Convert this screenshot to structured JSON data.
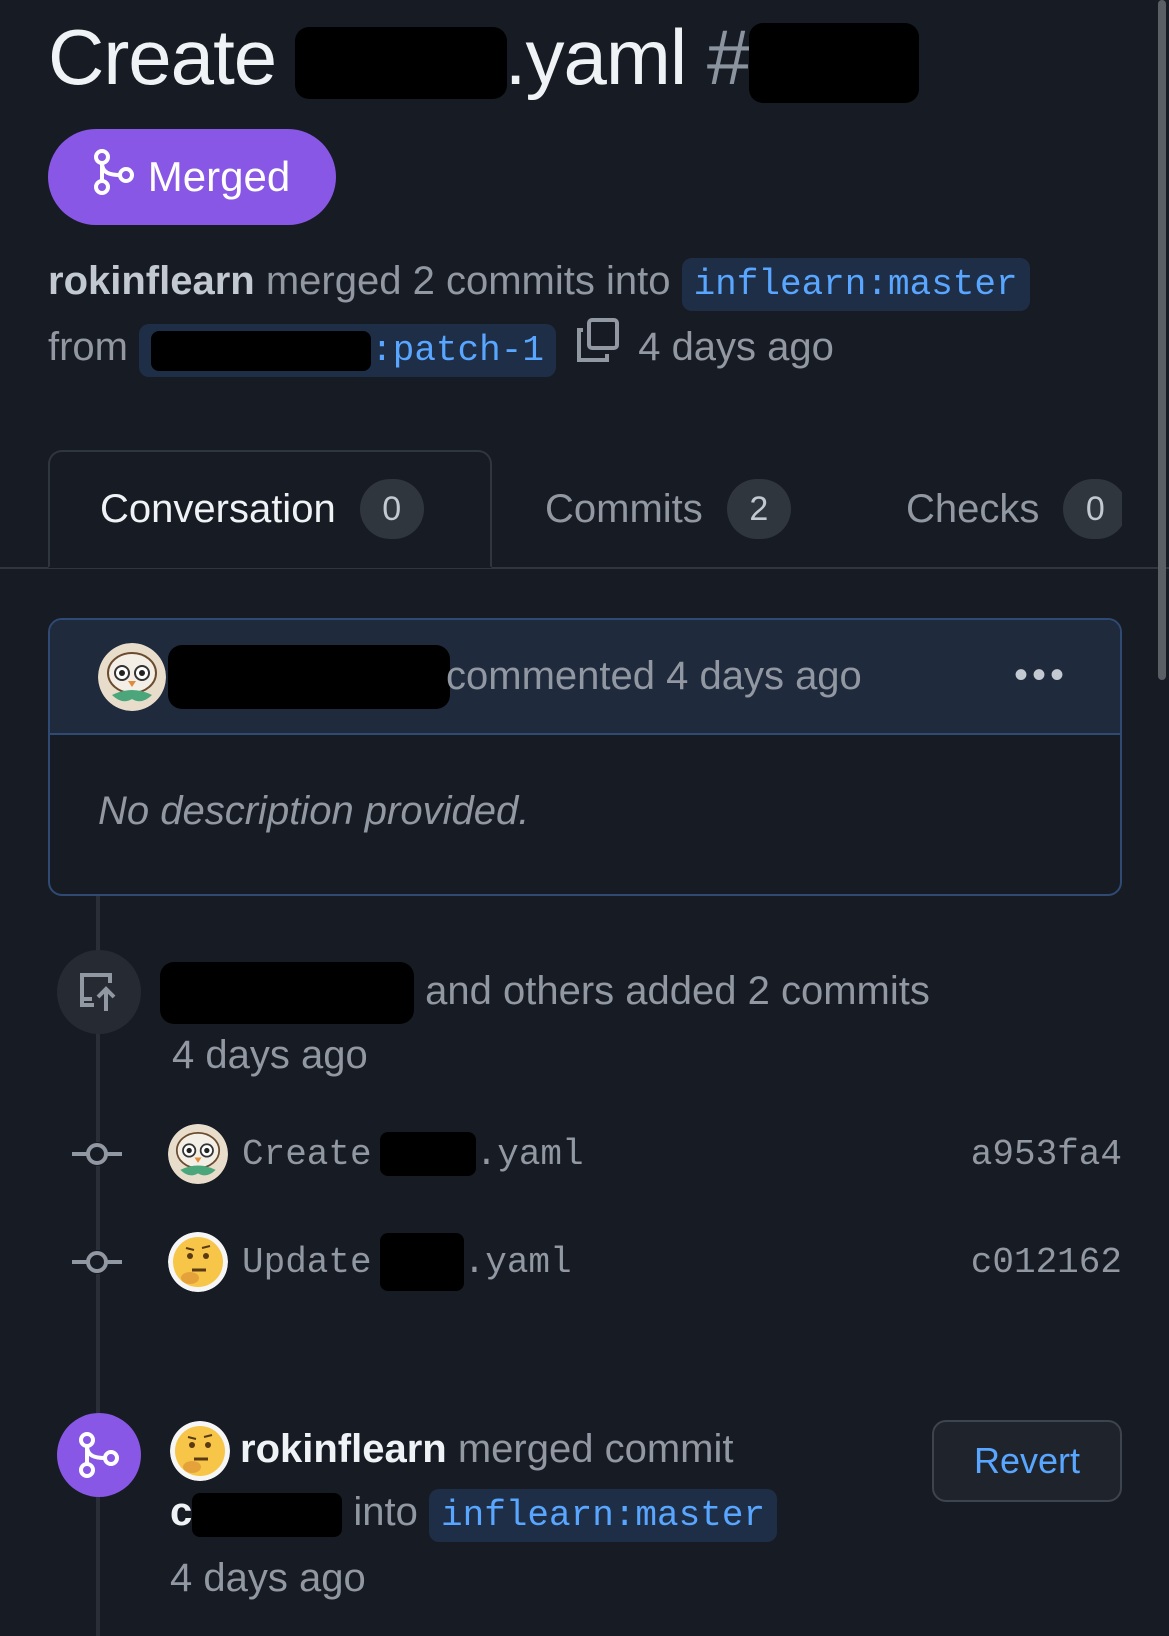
{
  "pr": {
    "title_prefix": "Create",
    "title_suffix": ".yaml",
    "number_hash": "#",
    "state_label": "Merged",
    "merger": "rokinflearn",
    "summary_text": "merged 2 commits into",
    "base_branch": "inflearn:master",
    "from_label": "from",
    "head_branch_suffix": ":patch-1",
    "merged_time": "4 days ago"
  },
  "tabs": [
    {
      "label": "Conversation",
      "count": "0"
    },
    {
      "label": "Commits",
      "count": "2"
    },
    {
      "label": "Checks",
      "count": "0"
    }
  ],
  "comment": {
    "action": "commented 4 days ago",
    "body": "No description provided."
  },
  "commits_event": {
    "text": "and others added 2 commits",
    "time": "4 days ago"
  },
  "commits": [
    {
      "verb": "Create",
      "file_suffix": ".yaml",
      "sha": "a953fa4",
      "avatar": "owl-avatar"
    },
    {
      "verb": "Update",
      "file_suffix": ".yaml",
      "sha": "c012162",
      "avatar": "thinking-face-avatar"
    }
  ],
  "merge_event": {
    "user": "rokinflearn",
    "text": "merged commit",
    "commit_prefix": "c",
    "into_label": "into",
    "branch": "inflearn:master",
    "time": "4 days ago",
    "revert_label": "Revert"
  },
  "colors": {
    "background": "#171b24",
    "merged_purple": "#8957e5",
    "link_blue": "#58a6ff",
    "muted_text": "#9198a1"
  }
}
